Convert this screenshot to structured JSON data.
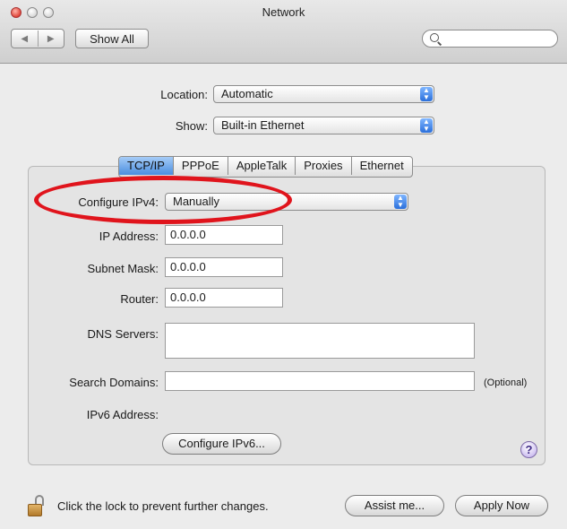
{
  "window": {
    "title": "Network"
  },
  "toolbar": {
    "back_icon": "◀",
    "forward_icon": "▶",
    "show_all_label": "Show All",
    "search_value": ""
  },
  "location": {
    "label": "Location:",
    "value": "Automatic"
  },
  "show": {
    "label": "Show:",
    "value": "Built-in Ethernet"
  },
  "tabs": [
    {
      "label": "TCP/IP",
      "active": true
    },
    {
      "label": "PPPoE",
      "active": false
    },
    {
      "label": "AppleTalk",
      "active": false
    },
    {
      "label": "Proxies",
      "active": false
    },
    {
      "label": "Ethernet",
      "active": false
    }
  ],
  "tcpip": {
    "configure_label": "Configure IPv4:",
    "configure_value": "Manually",
    "ip_label": "IP Address:",
    "ip_value": "0.0.0.0",
    "subnet_label": "Subnet Mask:",
    "subnet_value": "0.0.0.0",
    "router_label": "Router:",
    "router_value": "0.0.0.0",
    "dns_label": "DNS Servers:",
    "dns_value": "",
    "search_domains_label": "Search Domains:",
    "search_domains_value": "",
    "optional_label": "(Optional)",
    "ipv6_label": "IPv6 Address:",
    "configure_ipv6_label": "Configure IPv6...",
    "help_label": "?"
  },
  "footer": {
    "lock_text": "Click the lock to prevent further changes.",
    "assist_label": "Assist me...",
    "apply_label": "Apply Now"
  },
  "colors": {
    "highlight_ellipse": "#e0141c",
    "tab_active": "#4a8de0"
  }
}
